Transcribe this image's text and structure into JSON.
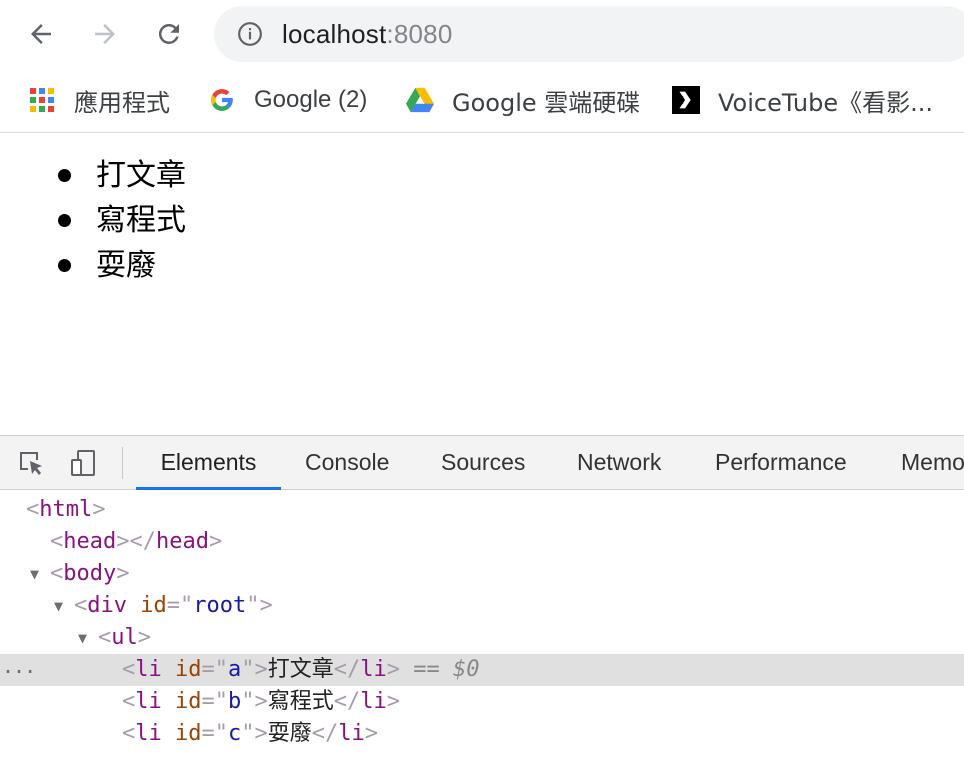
{
  "browser": {
    "url_host": "localhost",
    "url_port": ":8080"
  },
  "bookmarks": [
    {
      "label": "應用程式",
      "icon": "apps-grid-icon"
    },
    {
      "label": "Google (2)",
      "icon": "google-icon"
    },
    {
      "label": "Google 雲端硬碟",
      "icon": "google-drive-icon"
    },
    {
      "label": "VoiceTube《看影...",
      "icon": "voicetube-icon"
    }
  ],
  "page": {
    "list_items": [
      "打文章",
      "寫程式",
      "耍廢"
    ]
  },
  "devtools": {
    "tabs": [
      "Elements",
      "Console",
      "Sources",
      "Network",
      "Performance",
      "Memo"
    ],
    "active_tab": "Elements",
    "dom": {
      "html": "html",
      "head": "head",
      "body": "body",
      "div": "div",
      "div_attr": "id",
      "div_val": "root",
      "ul": "ul",
      "li": "li",
      "li_attr": "id",
      "li_items": [
        {
          "id": "a",
          "text": "打文章"
        },
        {
          "id": "b",
          "text": "寫程式"
        },
        {
          "id": "c",
          "text": "耍廢"
        }
      ],
      "selected_marker": "== $0",
      "ellipsis": "..."
    }
  }
}
